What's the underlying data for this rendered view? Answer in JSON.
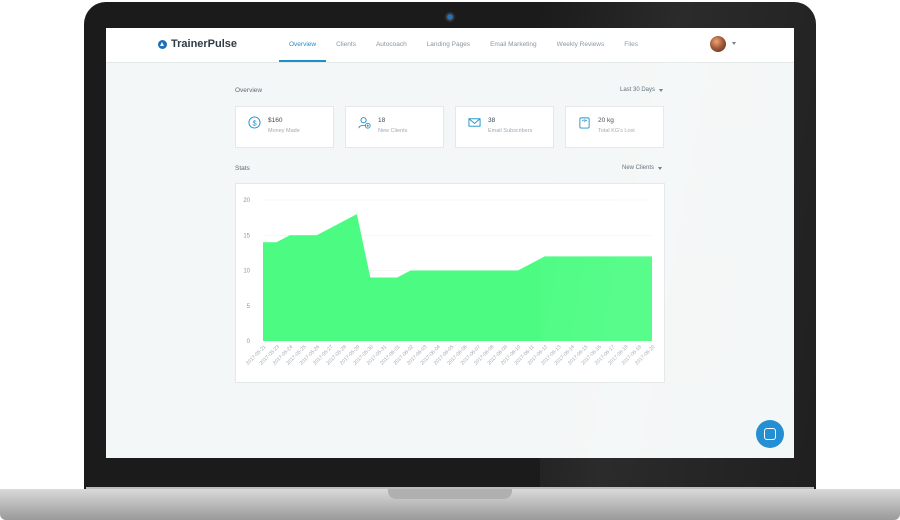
{
  "app": {
    "logo_text": "TrainerPulse"
  },
  "nav": {
    "items": [
      {
        "label": "Overview",
        "active": true
      },
      {
        "label": "Clients",
        "active": false
      },
      {
        "label": "Autocoach",
        "active": false
      },
      {
        "label": "Landing Pages",
        "active": false
      },
      {
        "label": "Email Marketing",
        "active": false
      },
      {
        "label": "Weekly Reviews",
        "active": false
      },
      {
        "label": "Files",
        "active": false
      }
    ]
  },
  "overview": {
    "title": "Overview",
    "range_label": "Last 30 Days",
    "cards": [
      {
        "icon": "dollar-icon",
        "value": "$160",
        "label": "Money Made"
      },
      {
        "icon": "add-user-icon",
        "value": "18",
        "label": "New Clients"
      },
      {
        "icon": "envelope-icon",
        "value": "38",
        "label": "Email Subscribers"
      },
      {
        "icon": "scale-icon",
        "value": "20 kg",
        "label": "Total KG's Lost"
      }
    ]
  },
  "stats": {
    "title": "Stats",
    "metric_label": "New Clients"
  },
  "colors": {
    "accent": "#1e90c8",
    "area_fill": "#4cfc82",
    "chat": "#1d8bd1"
  },
  "chart_data": {
    "type": "area",
    "x": [
      "2017-05-21",
      "2017-05-23",
      "2017-05-24",
      "2017-05-25",
      "2017-05-26",
      "2017-05-27",
      "2017-05-28",
      "2017-05-29",
      "2017-05-30",
      "2017-05-31",
      "2017-06-01",
      "2017-06-02",
      "2017-06-03",
      "2017-06-04",
      "2017-06-05",
      "2017-06-06",
      "2017-06-07",
      "2017-06-08",
      "2017-06-09",
      "2017-06-10",
      "2017-06-11",
      "2017-06-12",
      "2017-06-13",
      "2017-06-14",
      "2017-06-15",
      "2017-06-16",
      "2017-06-17",
      "2017-06-18",
      "2017-06-19",
      "2017-06-20"
    ],
    "y": [
      14,
      14,
      15,
      15,
      15,
      16,
      17,
      18,
      9,
      9,
      9,
      10,
      10,
      10,
      10,
      10,
      10,
      10,
      10,
      10,
      11,
      12,
      12,
      12,
      12,
      12,
      12,
      12,
      12,
      12
    ],
    "yticks": [
      0,
      5,
      10,
      15,
      20
    ],
    "ylim": [
      0,
      20
    ]
  }
}
